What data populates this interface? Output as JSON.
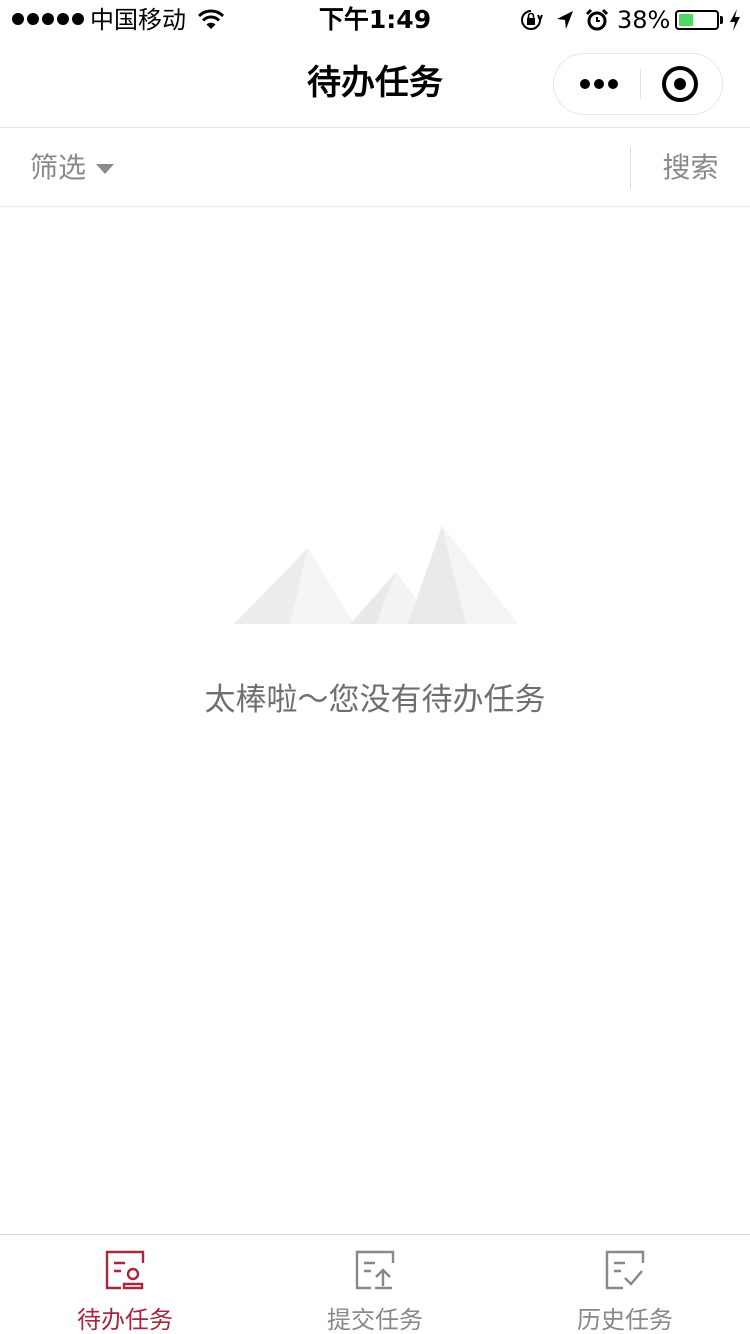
{
  "status_bar": {
    "carrier": "中国移动",
    "time": "下午1:49",
    "battery_percent_label": "38%",
    "battery_level": 0.38,
    "icons": [
      "signal-dots-icon",
      "wifi-icon",
      "rotation-lock-icon",
      "location-arrow-icon",
      "alarm-icon",
      "battery-icon",
      "charging-bolt-icon"
    ]
  },
  "nav": {
    "title": "待办任务",
    "capsule_icons": [
      "more-dots-icon",
      "close-miniprogram-icon"
    ]
  },
  "filter_bar": {
    "filter_label": "筛选",
    "search_label": "搜索"
  },
  "empty_state": {
    "message": "太棒啦～您没有待办任务",
    "illustration": "mountains-icon"
  },
  "tabs": [
    {
      "label": "待办任务",
      "icon": "pending-task-icon",
      "active": true
    },
    {
      "label": "提交任务",
      "icon": "submit-task-icon",
      "active": false
    },
    {
      "label": "历史任务",
      "icon": "history-task-icon",
      "active": false
    }
  ],
  "colors": {
    "active_tab": "#a8263f",
    "inactive_tab": "#888888",
    "battery_fill": "#4cd964",
    "muted_text": "#8a8a8a"
  }
}
